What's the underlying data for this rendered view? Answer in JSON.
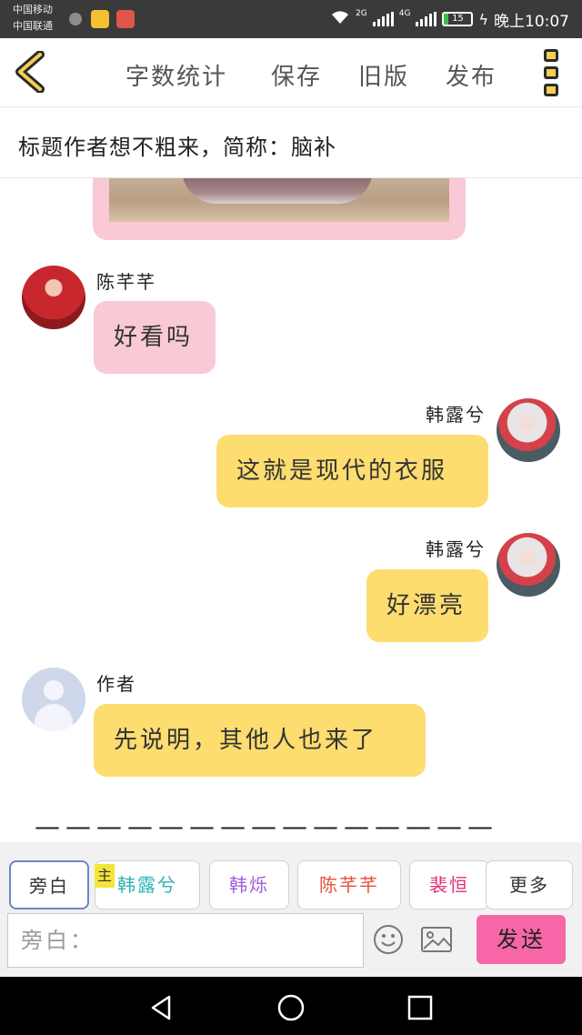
{
  "status_bar": {
    "carrier1": "中国移动",
    "carrier2": "中国联通",
    "net1": "2G",
    "net2": "4G",
    "battery": "15",
    "battery_level": 0.15,
    "time": "晚上10:07"
  },
  "toolbar": {
    "back_icon": "chevron-left-icon",
    "items": [
      "字数统计",
      "保存",
      "旧版",
      "发布"
    ],
    "menu_icon": "more-vertical-icon",
    "accent": "#f5d04e"
  },
  "title": "标题作者想不粗来，简称：脑补",
  "messages": [
    {
      "side": "left",
      "sender": "陈芊芊",
      "text": "好看吗",
      "color": "#f9c9d5"
    },
    {
      "side": "right",
      "sender": "韩露兮",
      "text": "这就是现代的衣服",
      "color": "#fddc70"
    },
    {
      "side": "right",
      "sender": "韩露兮",
      "text": "好漂亮",
      "color": "#fddc70"
    },
    {
      "side": "left",
      "sender": "作者",
      "text": "先说明，其他人也来了",
      "color": "#fddc70"
    }
  ],
  "divider": "———————————————",
  "characters": {
    "chips": [
      {
        "label": "旁白",
        "color": "#333333"
      },
      {
        "label": "韩露兮",
        "color": "#2bb3b5"
      },
      {
        "label": "韩烁",
        "color": "#a15bd8"
      },
      {
        "label": "陈芊芊",
        "color": "#e3523e"
      },
      {
        "label": "裴恒",
        "color": "#e0327c"
      },
      {
        "label": "更多",
        "color": "#333333"
      }
    ],
    "main_tag": "主"
  },
  "compose": {
    "placeholder": "旁白：",
    "send_label": "发送",
    "send_color": "#f767a8",
    "emoji_icon": "smiley-icon",
    "image_icon": "image-icon"
  },
  "nav": {
    "back_icon": "back-triangle-icon",
    "home_icon": "home-circle-icon",
    "recents_icon": "recents-square-icon"
  }
}
